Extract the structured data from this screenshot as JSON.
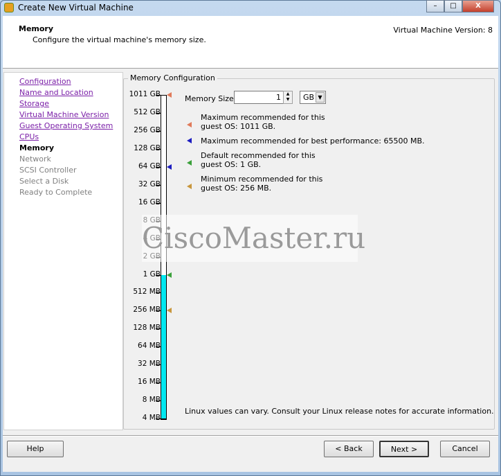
{
  "window": {
    "title": "Create New Virtual Machine",
    "minimize": "–",
    "maximize": "□",
    "close": "X"
  },
  "header": {
    "title": "Memory",
    "subtitle": "Configure the virtual machine's memory size.",
    "version": "Virtual Machine Version: 8"
  },
  "nav": {
    "items": [
      {
        "label": "Configuration",
        "state": "link"
      },
      {
        "label": "Name and Location",
        "state": "link"
      },
      {
        "label": "Storage",
        "state": "link"
      },
      {
        "label": "Virtual Machine Version",
        "state": "link"
      },
      {
        "label": "Guest Operating System",
        "state": "link"
      },
      {
        "label": "CPUs",
        "state": "link"
      },
      {
        "label": "Memory",
        "state": "current"
      },
      {
        "label": "Network",
        "state": "disabled"
      },
      {
        "label": "SCSI Controller",
        "state": "disabled"
      },
      {
        "label": "Select a Disk",
        "state": "disabled"
      },
      {
        "label": "Ready to Complete",
        "state": "disabled"
      }
    ]
  },
  "memory": {
    "group_title": "Memory Configuration",
    "size_label": "Memory Size:",
    "size_value": "1",
    "unit": "GB",
    "scale": [
      "1011 GB",
      "512 GB",
      "256 GB",
      "128 GB",
      "64 GB",
      "32 GB",
      "16 GB",
      "8 GB",
      "4 GB",
      "2 GB",
      "1 GB",
      "512 MB",
      "256 MB",
      "128 MB",
      "64 MB",
      "32 MB",
      "16 MB",
      "8 MB",
      "4 MB"
    ],
    "current_level": "1 GB",
    "markers": [
      {
        "text1": "Maximum recommended for this",
        "text2": "guest OS: 1011 GB.",
        "at": "1011 GB",
        "color": "#e07a5a"
      },
      {
        "text1": "Maximum recommended for best performance: 65500 MB.",
        "text2": "",
        "at": "64 GB",
        "color": "#1c1cc0"
      },
      {
        "text1": "Default recommended for this",
        "text2": "guest OS: 1 GB.",
        "at": "1 GB",
        "color": "#3aa03a"
      },
      {
        "text1": "Minimum recommended for this",
        "text2": "guest OS: 256 MB.",
        "at": "256 MB",
        "color": "#c8963c"
      }
    ],
    "fill_color": "#00e8f0",
    "note": "Linux values can vary. Consult your Linux release notes for accurate information."
  },
  "watermark": "CiscoMaster.ru",
  "buttons": {
    "help": "Help",
    "back": "< Back",
    "next": "Next >",
    "cancel": "Cancel"
  }
}
